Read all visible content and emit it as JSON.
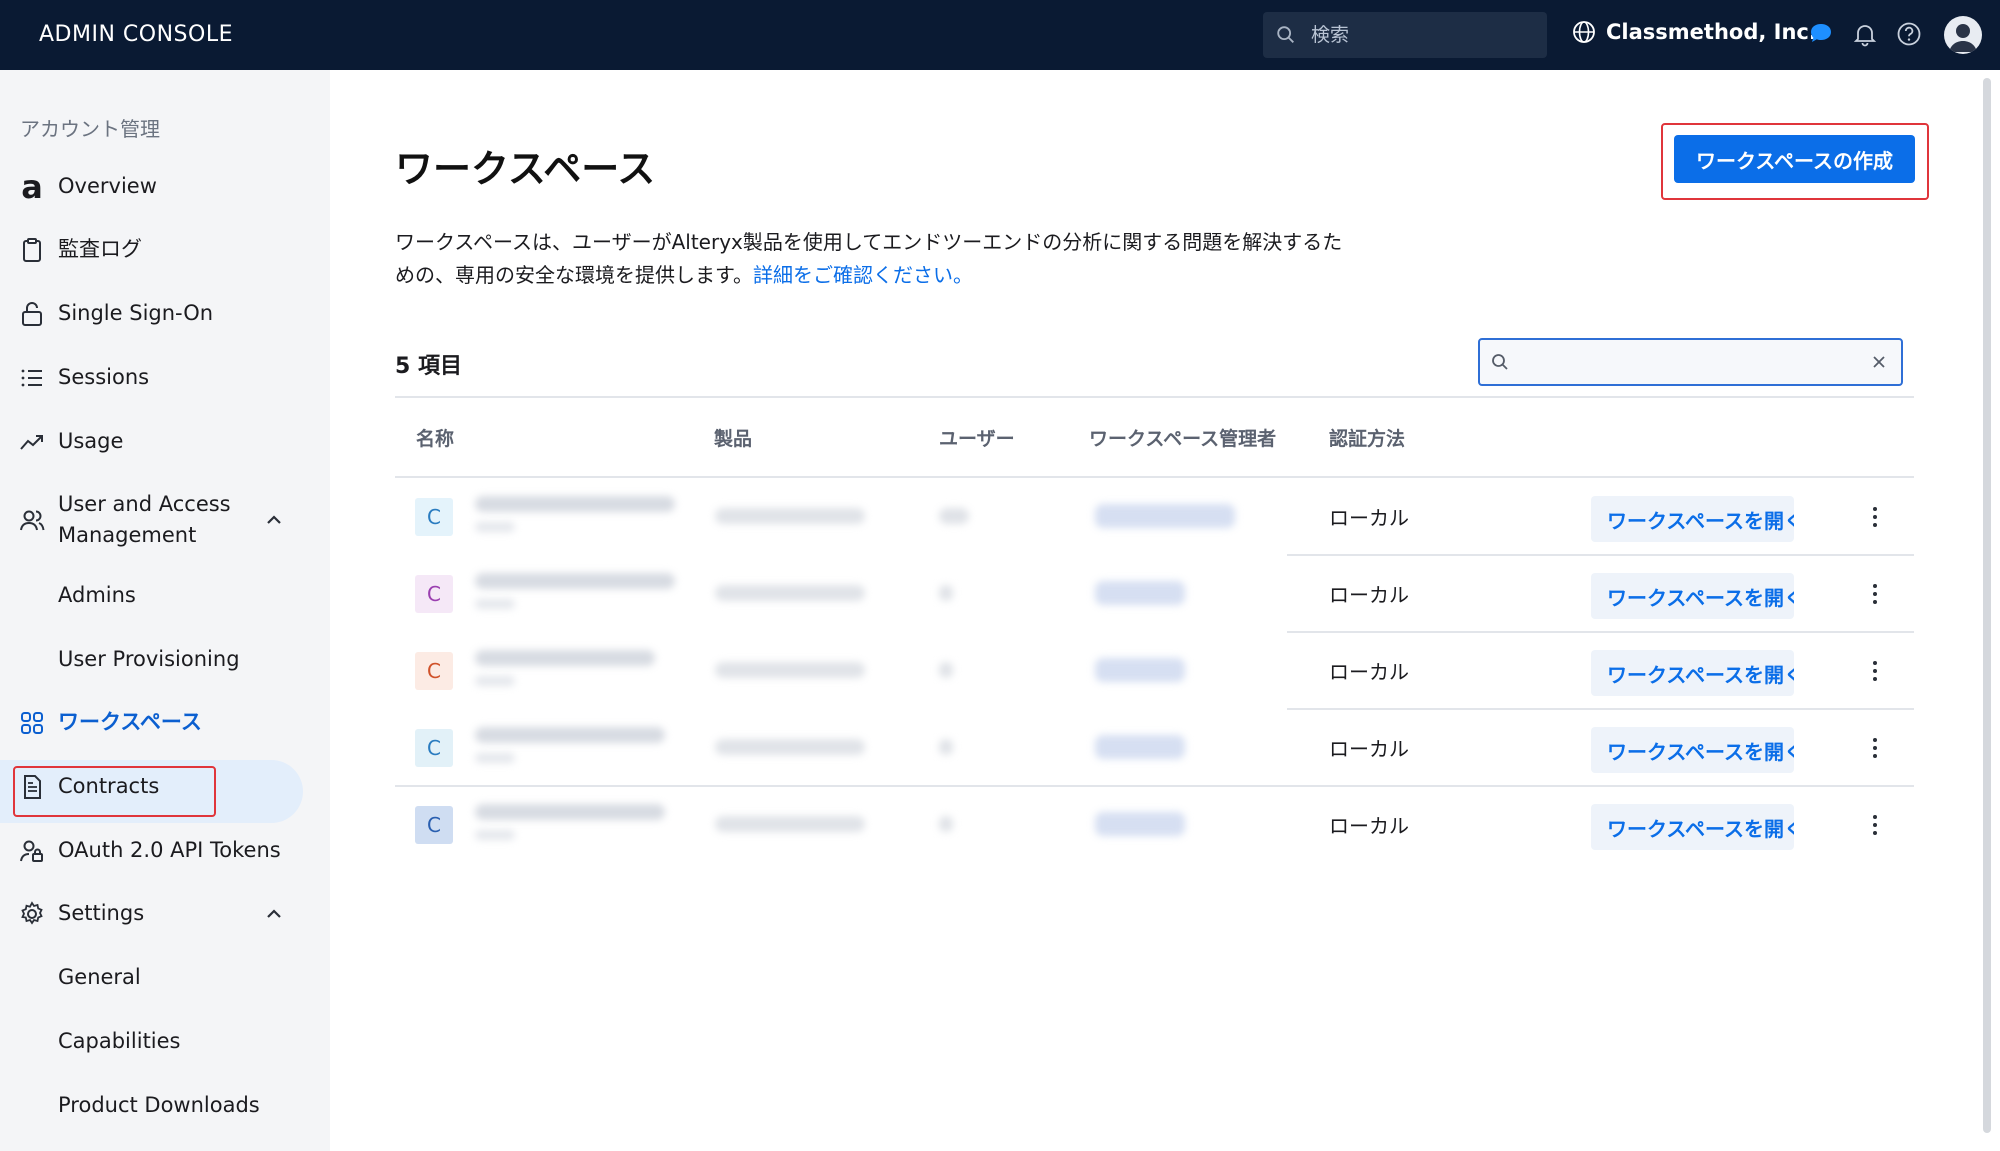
{
  "topbar": {
    "brand": "ADMIN CONSOLE",
    "search_placeholder": "検索",
    "org_name": "Classmethod, Inc.",
    "icons": [
      "search-icon",
      "globe-icon",
      "chat-icon",
      "bell-icon",
      "help-icon",
      "user-icon"
    ]
  },
  "sidebar": {
    "section_title": "アカウント管理",
    "items": [
      {
        "label": "Overview",
        "icon": "alteryx-a-icon"
      },
      {
        "label": "監査ログ",
        "icon": "clipboard-icon"
      },
      {
        "label": "Single Sign-On",
        "icon": "lock-icon"
      },
      {
        "label": "Sessions",
        "icon": "list-icon"
      },
      {
        "label": "Usage",
        "icon": "trend-icon"
      },
      {
        "label": "User and Access Management",
        "icon": "users-icon",
        "expanded": true
      },
      {
        "label": "Admins"
      },
      {
        "label": "User Provisioning"
      },
      {
        "label": "ワークスペース",
        "icon": "grid-icon",
        "active": true
      },
      {
        "label": "Contracts",
        "icon": "document-icon"
      },
      {
        "label": "OAuth 2.0 API Tokens",
        "icon": "user-key-icon"
      },
      {
        "label": "Settings",
        "icon": "gear-icon",
        "expanded": true
      },
      {
        "label": "General"
      },
      {
        "label": "Capabilities"
      },
      {
        "label": "Product Downloads"
      }
    ]
  },
  "main": {
    "title": "ワークスペース",
    "create_button": "ワークスペースの作成",
    "description_text": "ワークスペースは、ユーザーがAlteryx製品を使用してエンドツーエンドの分析に関する問題を解決するための、専用の安全な環境を提供します。",
    "description_link": "詳細をご確認ください。",
    "count": "5 項目",
    "filter_value": "",
    "columns": [
      "名称",
      "製品",
      "ユーザー",
      "ワークスペース管理者",
      "認証方法"
    ],
    "rows": [
      {
        "initial": "C",
        "chip_bg": "#e4f3fb",
        "chip_fg": "#2a7cc0",
        "auth": "ローカル",
        "open_label": "ワークスペースを開く"
      },
      {
        "initial": "C",
        "chip_bg": "#f5e8f7",
        "chip_fg": "#9b3fb0",
        "auth": "ローカル",
        "open_label": "ワークスペースを開く"
      },
      {
        "initial": "C",
        "chip_bg": "#fcebe4",
        "chip_fg": "#d0522a",
        "auth": "ローカル",
        "open_label": "ワークスペースを開く"
      },
      {
        "initial": "C",
        "chip_bg": "#e2f1f8",
        "chip_fg": "#2a7cc0",
        "auth": "ローカル",
        "open_label": "ワークスペースを開く"
      },
      {
        "initial": "C",
        "chip_bg": "#cfddf2",
        "chip_fg": "#2a5fb0",
        "auth": "ローカル",
        "open_label": "ワークスペースを開く"
      }
    ]
  },
  "colors": {
    "topbar_bg": "#0a1a33",
    "accent": "#0b6ee8",
    "highlight_border": "#e0353b",
    "sidebar_bg": "#f4f5f7",
    "active_bg": "#e3eefb"
  }
}
